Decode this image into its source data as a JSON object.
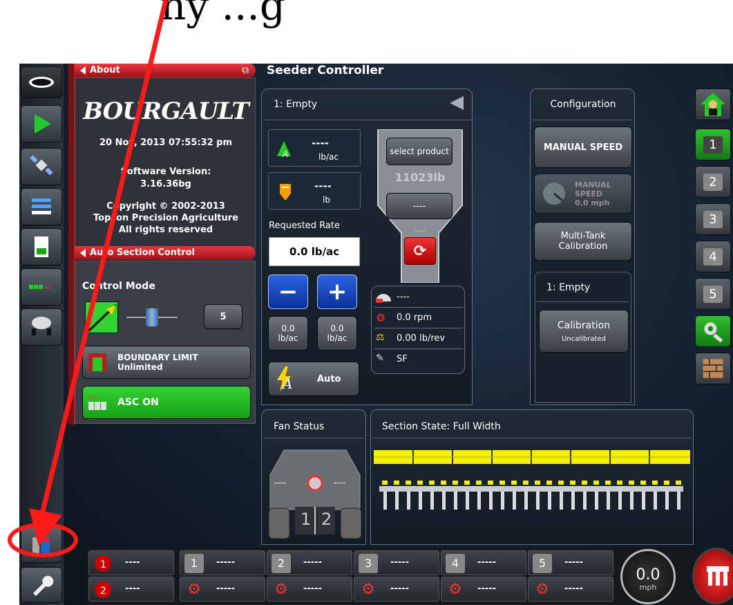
{
  "caption": "ny ...g",
  "title": "Seeder Controller",
  "about": {
    "header": "About",
    "logo": "BOURGAULT",
    "datetime": "20 Nov, 2013  07:55:32 pm",
    "software_label": "Software Version:",
    "software_version": "3.16.36bg",
    "copyright": "Copyright © 2002-2013",
    "company": "Topcon Precision Agriculture",
    "rights": "All rights reserved"
  },
  "asc": {
    "header": "Auto Section Control",
    "control_mode_label": "Control Mode",
    "mode_value": "5",
    "boundary_title": "BOUNDARY LIMIT",
    "boundary_value": "Unlimited",
    "asc_on": "ASC ON"
  },
  "product": {
    "tank_label": "1: Empty",
    "rate_value": "----",
    "rate_unit": "lb/ac",
    "qty_value": "----",
    "qty_unit": "lb",
    "requested_rate_label": "Requested Rate",
    "requested_rate_value": "0.0 lb/ac",
    "select_product": "select product",
    "weight": "11023lb",
    "hopper_value": "----",
    "hopper_value2": "----",
    "minus_rate": "0.0",
    "minus_unit": "lb/ac",
    "plus_rate": "0.0",
    "plus_unit": "lb/ac",
    "auto_label": "Auto",
    "stats": {
      "stat1": "----",
      "rpm": "0.0 rpm",
      "lbrev": "0.00 lb/rev",
      "sf": "SF"
    }
  },
  "configuration": {
    "header": "Configuration",
    "manual_speed_button": "MANUAL SPEED",
    "manual_speed_title": "MANUAL SPEED",
    "manual_speed_value": "0.0 mph",
    "multitank": "Multi-Tank Calibration",
    "tank_label": "1: Empty",
    "calibration_title": "Calibration",
    "calibration_status": "Uncalibrated"
  },
  "fan": {
    "header": "Fan Status",
    "left_value": "----",
    "right_value": "----",
    "label1": "1",
    "label2": "2"
  },
  "section": {
    "header": "Section State: Full Width"
  },
  "right_rail": {
    "tanks": [
      "1",
      "2",
      "3",
      "4",
      "5"
    ]
  },
  "bottom": {
    "fan1_value": "----",
    "fan2_value": "----",
    "tanks": [
      {
        "num": "1",
        "top": "-----",
        "bottom": "-----"
      },
      {
        "num": "2",
        "top": "-----",
        "bottom": "-----"
      },
      {
        "num": "3",
        "top": "-----",
        "bottom": "-----"
      },
      {
        "num": "4",
        "top": "-----",
        "bottom": "-----"
      },
      {
        "num": "5",
        "top": "-----",
        "bottom": "-----"
      }
    ],
    "speed_value": "0.0",
    "speed_unit": "mph"
  },
  "colors": {
    "accent_red": "#e33a40",
    "green": "#1fb81f",
    "blue": "#1f4fd0",
    "yellow": "#f4f000",
    "arrow_red": "#ff0000"
  }
}
